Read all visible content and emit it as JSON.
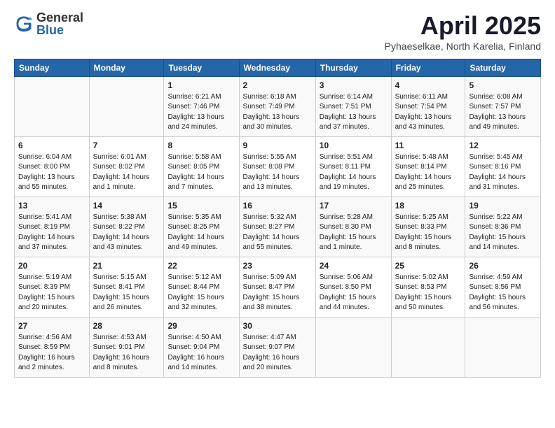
{
  "logo": {
    "general": "General",
    "blue": "Blue"
  },
  "header": {
    "month": "April 2025",
    "location": "Pyhaeselkae, North Karelia, Finland"
  },
  "days_of_week": [
    "Sunday",
    "Monday",
    "Tuesday",
    "Wednesday",
    "Thursday",
    "Friday",
    "Saturday"
  ],
  "weeks": [
    [
      {
        "day": "",
        "info": ""
      },
      {
        "day": "",
        "info": ""
      },
      {
        "day": "1",
        "info": "Sunrise: 6:21 AM\nSunset: 7:46 PM\nDaylight: 13 hours\nand 24 minutes."
      },
      {
        "day": "2",
        "info": "Sunrise: 6:18 AM\nSunset: 7:49 PM\nDaylight: 13 hours\nand 30 minutes."
      },
      {
        "day": "3",
        "info": "Sunrise: 6:14 AM\nSunset: 7:51 PM\nDaylight: 13 hours\nand 37 minutes."
      },
      {
        "day": "4",
        "info": "Sunrise: 6:11 AM\nSunset: 7:54 PM\nDaylight: 13 hours\nand 43 minutes."
      },
      {
        "day": "5",
        "info": "Sunrise: 6:08 AM\nSunset: 7:57 PM\nDaylight: 13 hours\nand 49 minutes."
      }
    ],
    [
      {
        "day": "6",
        "info": "Sunrise: 6:04 AM\nSunset: 8:00 PM\nDaylight: 13 hours\nand 55 minutes."
      },
      {
        "day": "7",
        "info": "Sunrise: 6:01 AM\nSunset: 8:02 PM\nDaylight: 14 hours\nand 1 minute."
      },
      {
        "day": "8",
        "info": "Sunrise: 5:58 AM\nSunset: 8:05 PM\nDaylight: 14 hours\nand 7 minutes."
      },
      {
        "day": "9",
        "info": "Sunrise: 5:55 AM\nSunset: 8:08 PM\nDaylight: 14 hours\nand 13 minutes."
      },
      {
        "day": "10",
        "info": "Sunrise: 5:51 AM\nSunset: 8:11 PM\nDaylight: 14 hours\nand 19 minutes."
      },
      {
        "day": "11",
        "info": "Sunrise: 5:48 AM\nSunset: 8:14 PM\nDaylight: 14 hours\nand 25 minutes."
      },
      {
        "day": "12",
        "info": "Sunrise: 5:45 AM\nSunset: 8:16 PM\nDaylight: 14 hours\nand 31 minutes."
      }
    ],
    [
      {
        "day": "13",
        "info": "Sunrise: 5:41 AM\nSunset: 8:19 PM\nDaylight: 14 hours\nand 37 minutes."
      },
      {
        "day": "14",
        "info": "Sunrise: 5:38 AM\nSunset: 8:22 PM\nDaylight: 14 hours\nand 43 minutes."
      },
      {
        "day": "15",
        "info": "Sunrise: 5:35 AM\nSunset: 8:25 PM\nDaylight: 14 hours\nand 49 minutes."
      },
      {
        "day": "16",
        "info": "Sunrise: 5:32 AM\nSunset: 8:27 PM\nDaylight: 14 hours\nand 55 minutes."
      },
      {
        "day": "17",
        "info": "Sunrise: 5:28 AM\nSunset: 8:30 PM\nDaylight: 15 hours\nand 1 minute."
      },
      {
        "day": "18",
        "info": "Sunrise: 5:25 AM\nSunset: 8:33 PM\nDaylight: 15 hours\nand 8 minutes."
      },
      {
        "day": "19",
        "info": "Sunrise: 5:22 AM\nSunset: 8:36 PM\nDaylight: 15 hours\nand 14 minutes."
      }
    ],
    [
      {
        "day": "20",
        "info": "Sunrise: 5:19 AM\nSunset: 8:39 PM\nDaylight: 15 hours\nand 20 minutes."
      },
      {
        "day": "21",
        "info": "Sunrise: 5:15 AM\nSunset: 8:41 PM\nDaylight: 15 hours\nand 26 minutes."
      },
      {
        "day": "22",
        "info": "Sunrise: 5:12 AM\nSunset: 8:44 PM\nDaylight: 15 hours\nand 32 minutes."
      },
      {
        "day": "23",
        "info": "Sunrise: 5:09 AM\nSunset: 8:47 PM\nDaylight: 15 hours\nand 38 minutes."
      },
      {
        "day": "24",
        "info": "Sunrise: 5:06 AM\nSunset: 8:50 PM\nDaylight: 15 hours\nand 44 minutes."
      },
      {
        "day": "25",
        "info": "Sunrise: 5:02 AM\nSunset: 8:53 PM\nDaylight: 15 hours\nand 50 minutes."
      },
      {
        "day": "26",
        "info": "Sunrise: 4:59 AM\nSunset: 8:56 PM\nDaylight: 15 hours\nand 56 minutes."
      }
    ],
    [
      {
        "day": "27",
        "info": "Sunrise: 4:56 AM\nSunset: 8:59 PM\nDaylight: 16 hours\nand 2 minutes."
      },
      {
        "day": "28",
        "info": "Sunrise: 4:53 AM\nSunset: 9:01 PM\nDaylight: 16 hours\nand 8 minutes."
      },
      {
        "day": "29",
        "info": "Sunrise: 4:50 AM\nSunset: 9:04 PM\nDaylight: 16 hours\nand 14 minutes."
      },
      {
        "day": "30",
        "info": "Sunrise: 4:47 AM\nSunset: 9:07 PM\nDaylight: 16 hours\nand 20 minutes."
      },
      {
        "day": "",
        "info": ""
      },
      {
        "day": "",
        "info": ""
      },
      {
        "day": "",
        "info": ""
      }
    ]
  ]
}
